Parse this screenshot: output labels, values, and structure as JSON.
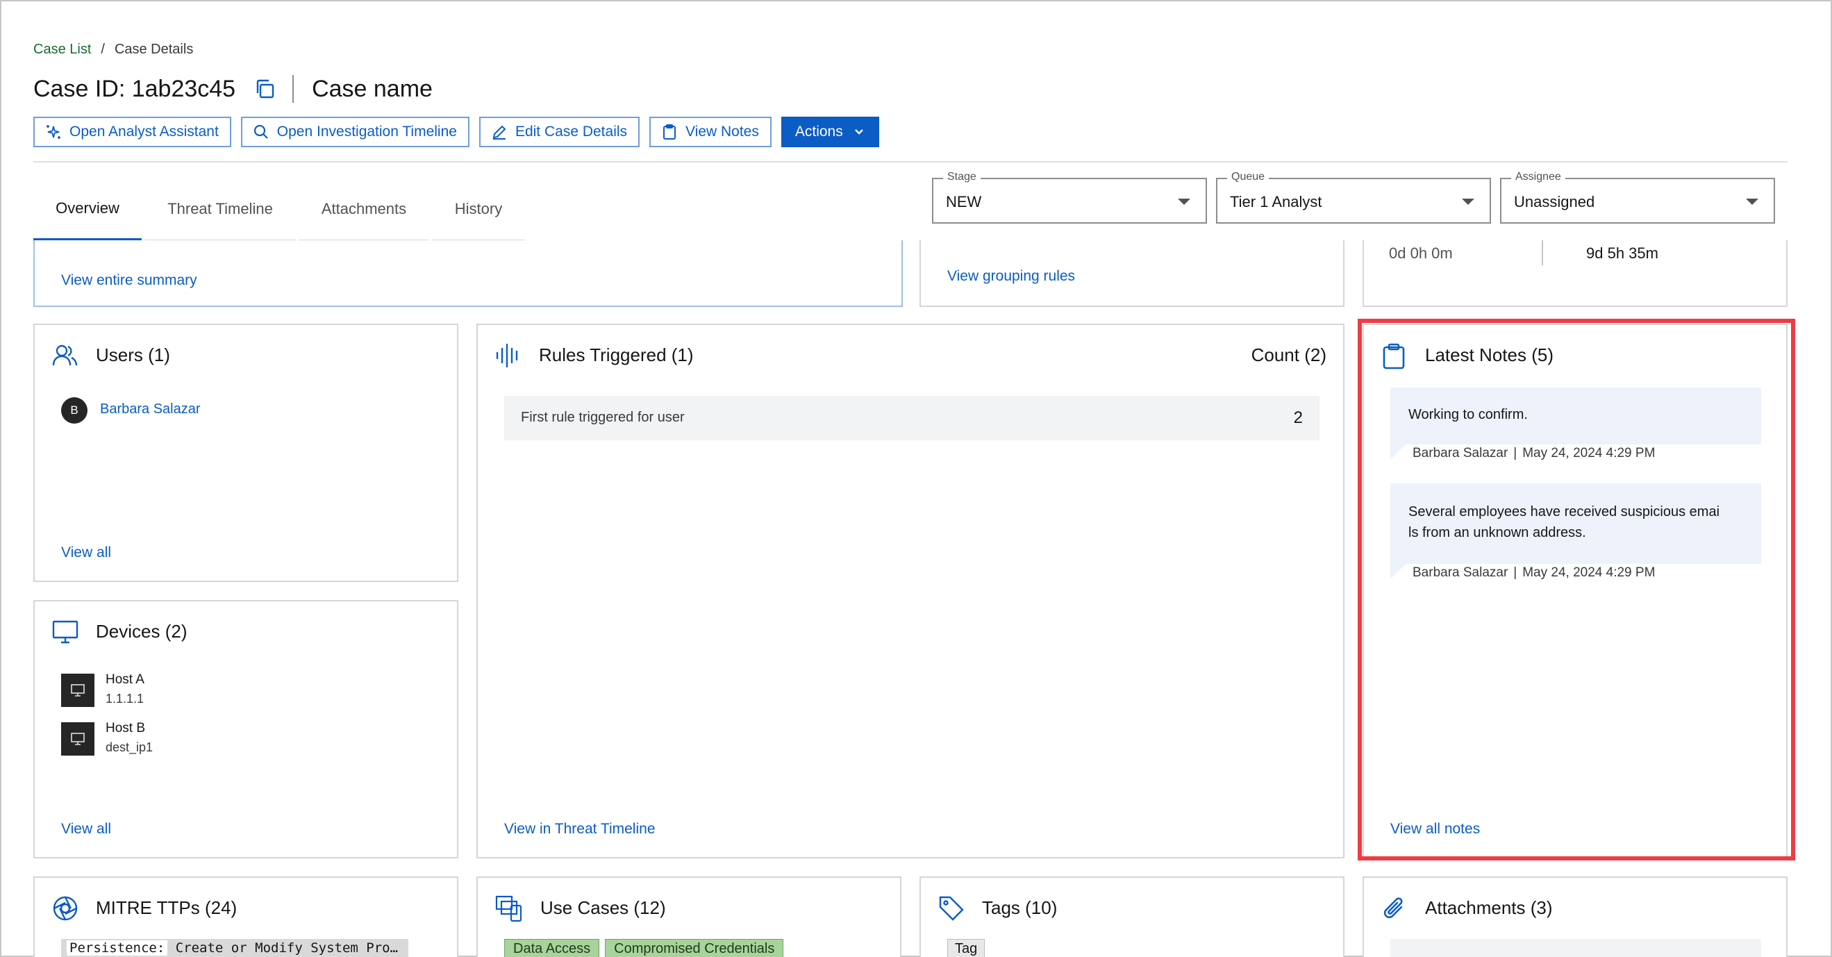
{
  "breadcrumb": {
    "parent": "Case List",
    "separator": "/",
    "current": "Case Details"
  },
  "header": {
    "case_id": "Case ID: 1ab23c45",
    "case_name": "Case name"
  },
  "actions": {
    "analyst_assistant": "Open Analyst Assistant",
    "investigation_timeline": "Open Investigation Timeline",
    "edit_case": "Edit Case Details",
    "view_notes": "View Notes",
    "actions_menu": "Actions"
  },
  "tabs": [
    {
      "label": "Overview",
      "active": true
    },
    {
      "label": "Threat Timeline"
    },
    {
      "label": "Attachments"
    },
    {
      "label": "History"
    }
  ],
  "fields": {
    "stage": {
      "label": "Stage",
      "value": "NEW"
    },
    "queue": {
      "label": "Queue",
      "value": "Tier 1 Analyst"
    },
    "assignee": {
      "label": "Assignee",
      "value": "Unassigned"
    }
  },
  "summary": {
    "link": "View entire summary"
  },
  "grouping": {
    "link": "View grouping rules"
  },
  "timers": {
    "left": "0d 0h 0m",
    "right": "9d 5h 35m"
  },
  "users": {
    "title": "Users (1)",
    "items": [
      {
        "initial": "B",
        "name": "Barbara Salazar"
      }
    ],
    "view_all": "View all"
  },
  "devices": {
    "title": "Devices (2)",
    "items": [
      {
        "name": "Host A",
        "ip": "1.1.1.1"
      },
      {
        "name": "Host B",
        "ip": "dest_ip1"
      }
    ],
    "view_all": "View all"
  },
  "rules": {
    "title": "Rules Triggered (1)",
    "count_label": "Count (2)",
    "items": [
      {
        "name": "First rule triggered for user",
        "count": "2"
      }
    ],
    "view_link": "View in Threat Timeline"
  },
  "notes": {
    "title": "Latest Notes (5)",
    "items": [
      {
        "text": "Working to confirm.",
        "author": "Barbara Salazar",
        "date": "May 24, 2024 4:29 PM"
      },
      {
        "text_line1": "Several employees have received suspicious emai",
        "text_line2": "ls from an unknown address.",
        "author": "Barbara Salazar",
        "date": "May 24, 2024 4:29 PM"
      }
    ],
    "view_all": "View all notes",
    "highlight_color": "#ef3b43"
  },
  "mitre": {
    "title": "MITRE TTPs (24)",
    "chip_key": "Persistence:",
    "chip_value": "Create or Modify System Pro…"
  },
  "use_cases": {
    "title": "Use Cases (12)",
    "chips": [
      "Data Access",
      "Compromised Credentials"
    ]
  },
  "tags": {
    "title": "Tags (10)",
    "chips": [
      "Tag"
    ]
  },
  "attachments": {
    "title": "Attachments (3)"
  },
  "colors": {
    "accent": "#0b5cc5",
    "breadcrumb_link": "#1a6b2e"
  }
}
